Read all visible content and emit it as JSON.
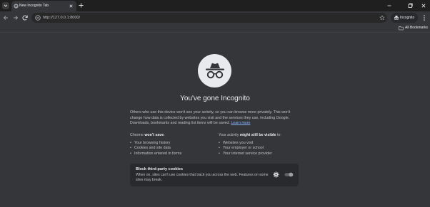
{
  "tabstrip": {
    "tab_title": "New Incognito Tab"
  },
  "toolbar": {
    "url": "http://127.0.0.1:8000/",
    "incognito_label": "Incognito"
  },
  "bookmarks": {
    "all_bookmarks_label": "All Bookmarks"
  },
  "ntp": {
    "headline": "You've gone Incognito",
    "intro_text": "Others who use this device won't see your activity, so you can browse more privately. This won't change how data is collected by websites you visit and the services they use, including Google. Downloads, bookmarks and reading list items will be saved.",
    "learn_more": "Learn more",
    "left_heading_prefix": "Chrome ",
    "left_heading_bold": "won't save",
    "left_heading_suffix": ":",
    "left_items": [
      "Your browsing history",
      "Cookies and site data",
      "Information entered in forms"
    ],
    "right_heading_prefix": "Your activity ",
    "right_heading_bold": "might still be visible",
    "right_heading_suffix": " to:",
    "right_items": [
      "Websites you visit",
      "Your employer or school",
      "Your internet service provider"
    ],
    "cookie_title": "Block third-party cookies",
    "cookie_desc": "When on, sites can't use cookies that track you across the web. Features on some sites may break."
  },
  "colors": {
    "background": "#35363a",
    "tabstrip": "#1f1f1f",
    "link": "#8ab4f8",
    "card": "#292a2d"
  },
  "state": {
    "block_third_party_cookies": false
  }
}
